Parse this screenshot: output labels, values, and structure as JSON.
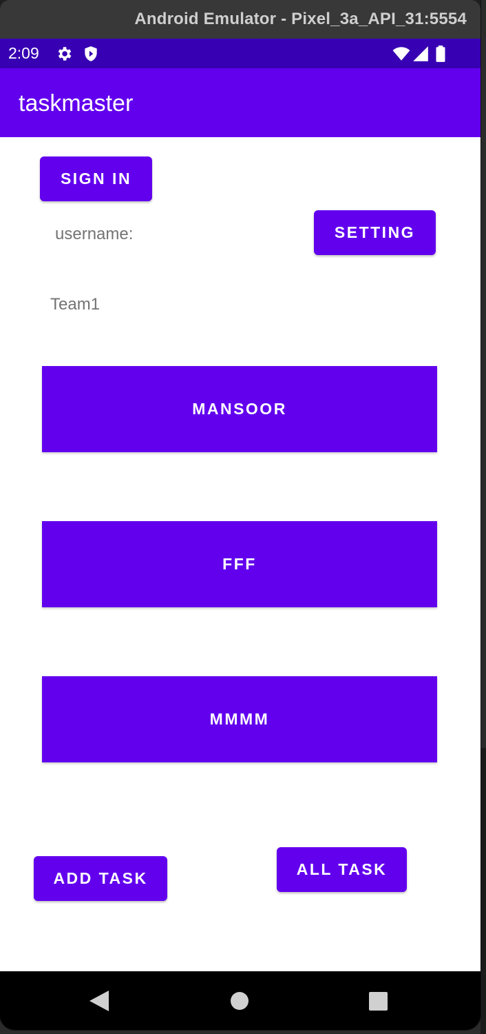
{
  "window": {
    "title": "Android Emulator - Pixel_3a_API_31:5554"
  },
  "status_bar": {
    "time": "2:09",
    "icons": [
      "settings-icon",
      "shield-icon",
      "wifi-icon",
      "signal-icon",
      "battery-icon"
    ]
  },
  "app_bar": {
    "title": "taskmaster"
  },
  "main": {
    "sign_in_label": "SIGN IN",
    "username_label": "username:",
    "setting_label": "SETTING",
    "team_label": "Team1",
    "tasks": [
      "MANSOOR",
      "FFF",
      "MMMM"
    ],
    "add_task_label": "ADD TASK",
    "all_task_label": "ALL TASK"
  },
  "navigation": {
    "icons": [
      "back-icon",
      "home-icon",
      "recents-icon"
    ]
  },
  "colors": {
    "primary": "#6200ee",
    "primary_dark": "#3700b3",
    "label_text": "#737373",
    "background": "#ffffff"
  }
}
